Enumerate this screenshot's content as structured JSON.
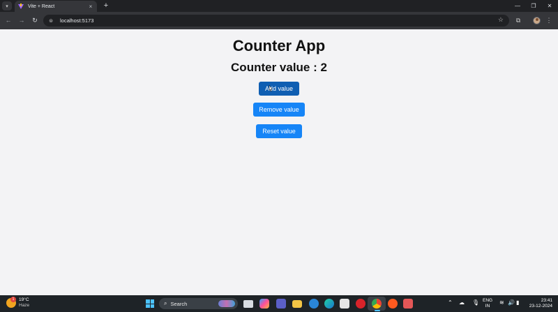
{
  "browser": {
    "tab_title": "Vite + React",
    "tab_close": "×",
    "new_tab": "+",
    "url": "localhost:5173",
    "win_minimize": "—",
    "win_maximize": "❐",
    "win_close": "✕"
  },
  "app": {
    "title": "Counter App",
    "counter_label": "Counter value : 2",
    "counter_value": 2,
    "buttons": {
      "add": "Add value",
      "remove": "Remove value",
      "reset": "Reset value"
    },
    "colors": {
      "button": "#1685f7",
      "button_active": "#0f5eb2",
      "background": "#f3f3f5"
    }
  },
  "taskbar": {
    "weather_temp": "19°C",
    "weather_condition": "Haze",
    "weather_badge": "1",
    "search_label": "Search",
    "lang_top": "ENG",
    "lang_bottom": "IN",
    "time": "23:41",
    "date": "23-12-2024"
  },
  "icons": [
    "tab-search-icon",
    "vite-favicon-icon",
    "back-arrow-icon",
    "forward-arrow-icon",
    "reload-icon",
    "site-info-icon",
    "star-icon",
    "extensions-icon",
    "profile-avatar",
    "menu-dots-icon",
    "windows-start-icon",
    "search-icon",
    "cloud-icon",
    "microphone-icon",
    "wifi-icon",
    "volume-icon",
    "battery-icon"
  ]
}
